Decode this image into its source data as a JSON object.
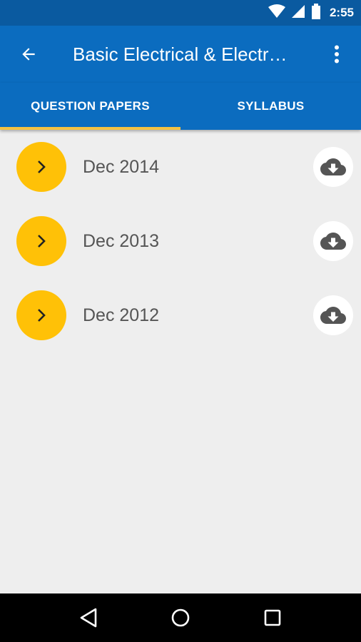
{
  "status_bar": {
    "time": "2:55",
    "icons": [
      "wifi-icon",
      "cellular-signal-icon",
      "battery-icon"
    ]
  },
  "app_bar": {
    "title": "Basic Electrical & Electr…",
    "back_icon": "arrow-back-icon",
    "menu_icon": "more-vert-icon"
  },
  "tabs": [
    {
      "label": "QUESTION PAPERS",
      "active": true
    },
    {
      "label": "SYLLABUS",
      "active": false
    }
  ],
  "papers": [
    {
      "label": "Dec 2014"
    },
    {
      "label": "Dec 2013"
    },
    {
      "label": "Dec 2012"
    }
  ],
  "colors": {
    "status_bar": "#0a5aa0",
    "primary": "#0b6cbf",
    "accent": "#ffc107",
    "tab_indicator": "#f5c242",
    "background": "#eeeeee"
  }
}
